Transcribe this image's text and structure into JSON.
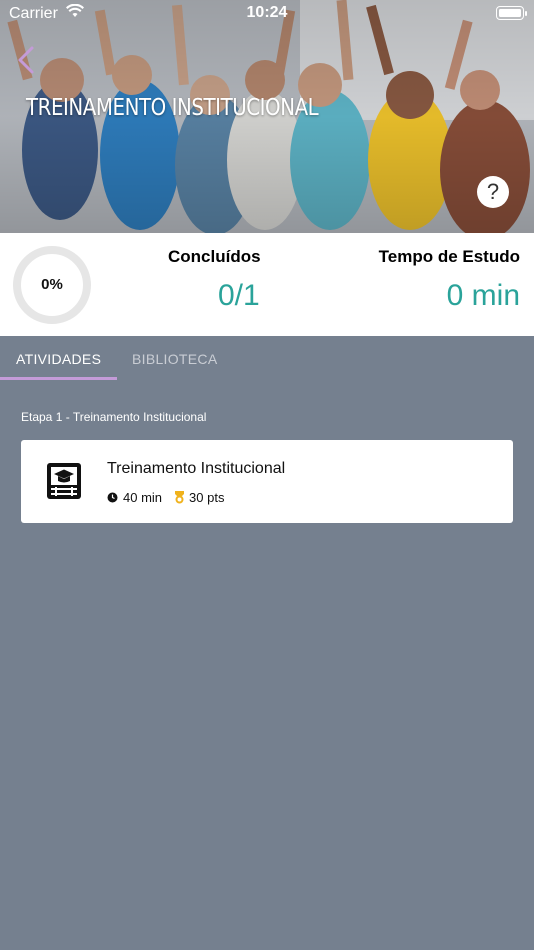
{
  "status_bar": {
    "carrier": "Carrier",
    "time": "10:24"
  },
  "header": {
    "title": "TREINAMENTO INSTITUCIONAL",
    "back_icon": "chevron-left-icon",
    "help_label": "?"
  },
  "stats": {
    "progress_percent": 0,
    "progress_label": "0%",
    "completed": {
      "label": "Concluídos",
      "value": "0/1"
    },
    "study_time": {
      "label": "Tempo de Estudo",
      "value": "0 min"
    }
  },
  "tabs": [
    {
      "label": "ATIVIDADES",
      "active": true
    },
    {
      "label": "BIBLIOTECA",
      "active": false
    }
  ],
  "stage": {
    "label": "Etapa 1 - Treinamento Institucional",
    "activities": [
      {
        "title": "Treinamento Institucional",
        "duration": "40 min",
        "points": "30 pts",
        "icon": "graduation-cap-icon"
      }
    ]
  },
  "colors": {
    "accent": "#2aa39a",
    "tab_indicator": "#c49bd8",
    "background": "#75808f"
  }
}
